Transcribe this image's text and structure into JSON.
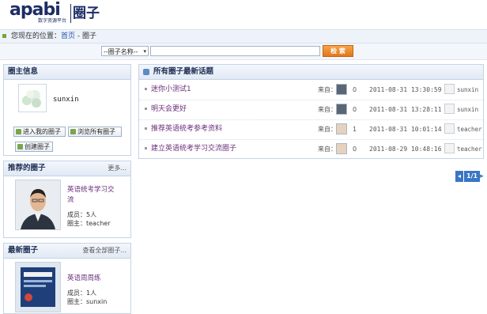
{
  "header": {
    "logo_text": "apabi",
    "logo_tagline": "数字资源平台",
    "section_title": "圈子"
  },
  "breadcrumb": {
    "prefix": "您现在的位置：",
    "home": "首页",
    "separator": " - ",
    "current": "圈子"
  },
  "search": {
    "select_value": "--圈子名称--",
    "input_value": "",
    "button_label": "检 索"
  },
  "owner_panel": {
    "title": "圈主信息",
    "username": "sunxin",
    "enter_button": "进入我的圈子",
    "browse_button": "浏览所有圈子",
    "create_button": "创建圈子"
  },
  "recommended": {
    "title": "推荐的圈子",
    "more": "更多...",
    "item": {
      "name_line1": "英语统考学习交",
      "name_line2": "流",
      "members": "成员：5人",
      "owner": "圈主：teacher"
    }
  },
  "latest": {
    "title": "最新圈子",
    "view_all": "查看全部圈子...",
    "item": {
      "name": "英语周周练",
      "members": "成员：1人",
      "owner": "圈主：sunxin"
    }
  },
  "topics": {
    "title": "所有圈子最新话题",
    "from_label": "来自：",
    "rows": [
      {
        "title": "迷你小测试1",
        "count": "0",
        "time": "2011-08-31 13:30:59",
        "author": "sunxin",
        "thumb": "dark"
      },
      {
        "title": "明天会更好",
        "count": "0",
        "time": "2011-08-31 13:28:11",
        "author": "sunxin",
        "thumb": "dark"
      },
      {
        "title": "推荐英语统考参考资料",
        "count": "1",
        "time": "2011-08-31 10:01:14",
        "author": "teacher",
        "thumb": "face"
      },
      {
        "title": "建立英语统考学习交流圈子",
        "count": "0",
        "time": "2011-08-29 10:48:16",
        "author": "teacher",
        "thumb": "face"
      }
    ]
  },
  "pagination": {
    "prev": "◂",
    "page": "1/1",
    "next": "▸"
  },
  "colors": {
    "link_purple": "#6a2f7a",
    "accent_blue": "#3a76c4",
    "search_orange": "#e2761b"
  }
}
